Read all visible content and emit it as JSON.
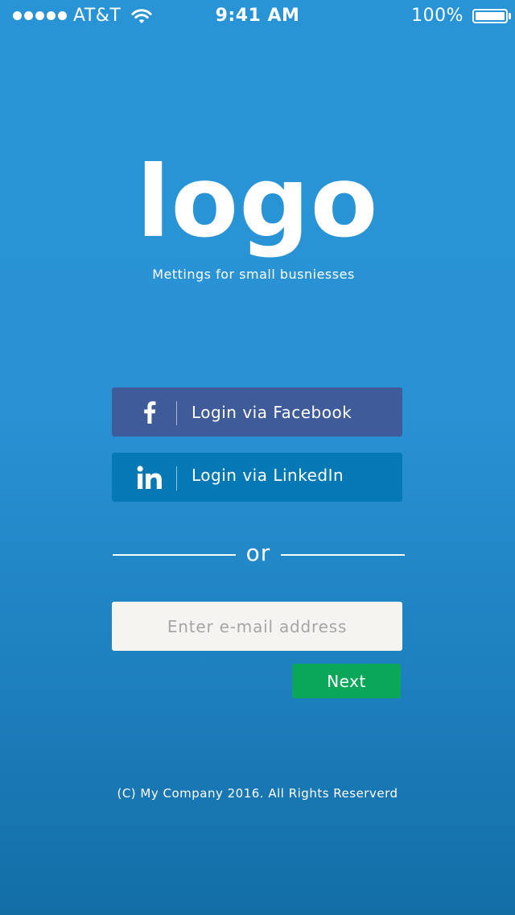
{
  "status_bar": {
    "carrier": "AT&T",
    "time": "9:41 AM",
    "battery": "100%"
  },
  "branding": {
    "logo": "logo",
    "tagline": "Mettings for small busniesses"
  },
  "login": {
    "facebook_label": "Login via Facebook",
    "linkedin_label": "Login via LinkedIn",
    "separator": "or"
  },
  "email": {
    "placeholder": "Enter e-mail address",
    "value": ""
  },
  "next_label": "Next",
  "footer": {
    "copyright": "(C) My Company 2016. All Rights Reserverd"
  },
  "colors": {
    "background": "#2894d6",
    "facebook": "#3f5b99",
    "linkedin": "#0479b6",
    "next": "#0aa759",
    "input": "#f6f4f0"
  },
  "icons": {
    "facebook": "facebook-icon",
    "linkedin": "linkedin-icon",
    "wifi": "wifi-icon",
    "battery": "battery-icon"
  }
}
